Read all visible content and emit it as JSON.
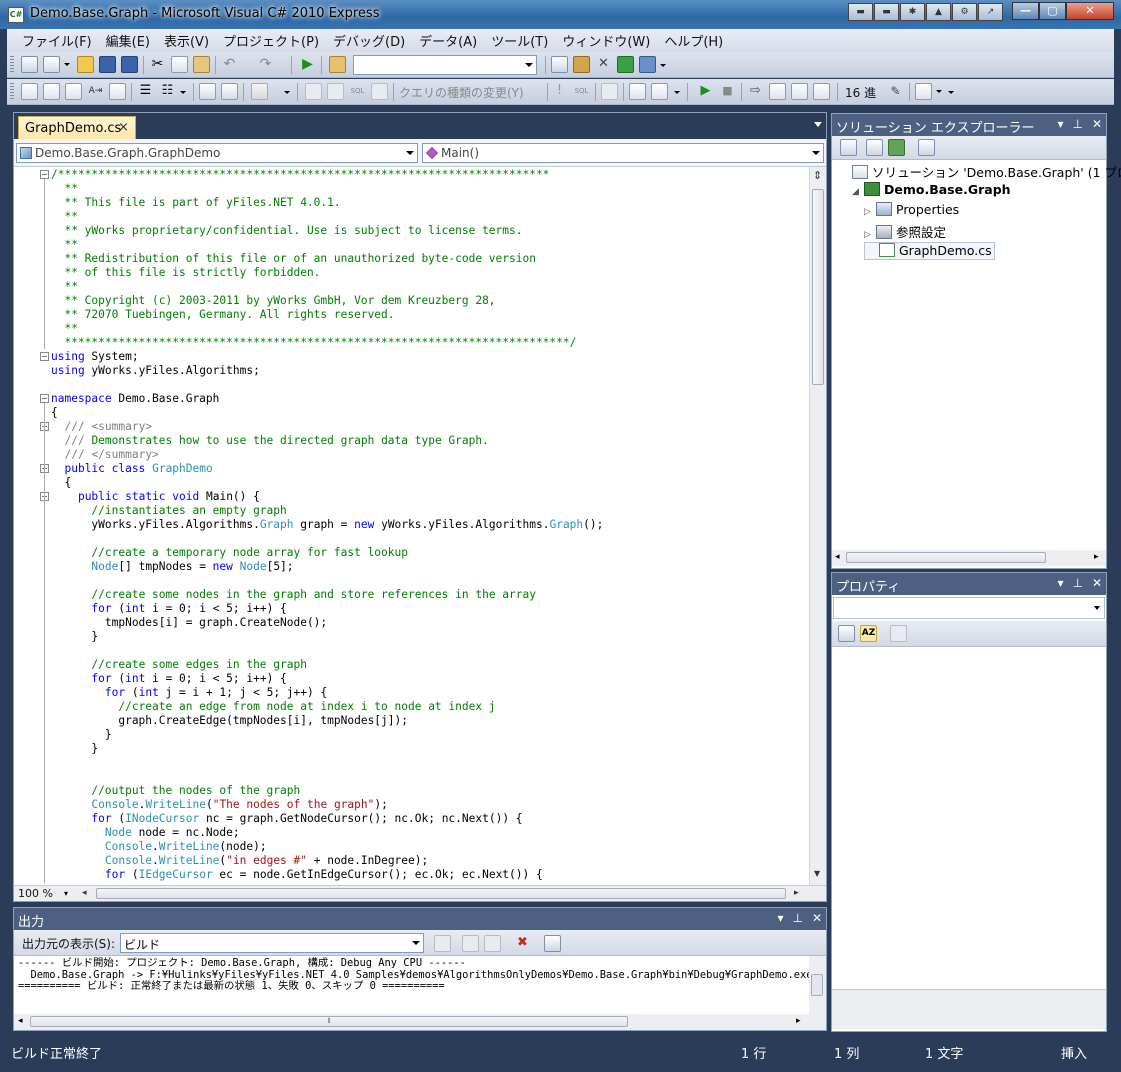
{
  "window": {
    "title": "Demo.Base.Graph - Microsoft Visual C# 2010 Express",
    "app_icon": "C#"
  },
  "menu": [
    "ファイル(F)",
    "編集(E)",
    "表示(V)",
    "プロジェクト(P)",
    "デバッグ(D)",
    "データ(A)",
    "ツール(T)",
    "ウィンドウ(W)",
    "ヘルプ(H)"
  ],
  "toolbar": {
    "query_type_label": "クエリの種類の変更(Y)",
    "hex_label": "16 進"
  },
  "editor": {
    "tab_label": "GraphDemo.cs",
    "tab_close": "×",
    "type_combo": "Demo.Base.Graph.GraphDemo",
    "member_combo": "Main()",
    "zoom": "100 %",
    "code_lines": [
      [
        [
          "cm",
          "/*************************************************************************"
        ]
      ],
      [
        [
          "cm",
          "  **"
        ]
      ],
      [
        [
          "cm",
          "  ** This file is part of yFiles.NET 4.0.1."
        ]
      ],
      [
        [
          "cm",
          "  **"
        ]
      ],
      [
        [
          "cm",
          "  ** yWorks proprietary/confidential. Use is subject to license terms."
        ]
      ],
      [
        [
          "cm",
          "  **"
        ]
      ],
      [
        [
          "cm",
          "  ** Redistribution of this file or of an unauthorized byte-code version"
        ]
      ],
      [
        [
          "cm",
          "  ** of this file is strictly forbidden."
        ]
      ],
      [
        [
          "cm",
          "  **"
        ]
      ],
      [
        [
          "cm",
          "  ** Copyright (c) 2003-2011 by yWorks GmbH, Vor dem Kreuzberg 28,"
        ]
      ],
      [
        [
          "cm",
          "  ** 72070 Tuebingen, Germany. All rights reserved."
        ]
      ],
      [
        [
          "cm",
          "  **"
        ]
      ],
      [
        [
          "cm",
          "  ***************************************************************************/"
        ]
      ],
      [
        [
          "kw",
          "using"
        ],
        [
          "nm",
          " System;"
        ]
      ],
      [
        [
          "kw",
          "using"
        ],
        [
          "nm",
          " yWorks.yFiles.Algorithms;"
        ]
      ],
      [],
      [
        [
          "kw",
          "namespace"
        ],
        [
          "nm",
          " Demo.Base.Graph"
        ]
      ],
      [
        [
          "nm",
          "{"
        ]
      ],
      [
        [
          "nm",
          "  "
        ],
        [
          "xd",
          "///"
        ],
        [
          "xd",
          " <summary>"
        ]
      ],
      [
        [
          "nm",
          "  "
        ],
        [
          "xd",
          "///"
        ],
        [
          "cm",
          " Demonstrates how to use the directed graph data type Graph."
        ]
      ],
      [
        [
          "nm",
          "  "
        ],
        [
          "xd",
          "///"
        ],
        [
          "xd",
          " </summary>"
        ]
      ],
      [
        [
          "nm",
          "  "
        ],
        [
          "kw",
          "public"
        ],
        [
          "nm",
          " "
        ],
        [
          "kw",
          "class"
        ],
        [
          "nm",
          " "
        ],
        [
          "ty",
          "GraphDemo"
        ]
      ],
      [
        [
          "nm",
          "  {"
        ]
      ],
      [
        [
          "nm",
          "    "
        ],
        [
          "kw",
          "public"
        ],
        [
          "nm",
          " "
        ],
        [
          "kw",
          "static"
        ],
        [
          "nm",
          " "
        ],
        [
          "kw",
          "void"
        ],
        [
          "nm",
          " Main() {"
        ]
      ],
      [
        [
          "nm",
          "      "
        ],
        [
          "cm",
          "//instantiates an empty graph"
        ]
      ],
      [
        [
          "nm",
          "      yWorks.yFiles.Algorithms."
        ],
        [
          "ty",
          "Graph"
        ],
        [
          "nm",
          " graph = "
        ],
        [
          "kw",
          "new"
        ],
        [
          "nm",
          " yWorks.yFiles.Algorithms."
        ],
        [
          "ty",
          "Graph"
        ],
        [
          "nm",
          "();"
        ]
      ],
      [],
      [
        [
          "nm",
          "      "
        ],
        [
          "cm",
          "//create a temporary node array for fast lookup"
        ]
      ],
      [
        [
          "nm",
          "      "
        ],
        [
          "ty",
          "Node"
        ],
        [
          "nm",
          "[] tmpNodes = "
        ],
        [
          "kw",
          "new"
        ],
        [
          "nm",
          " "
        ],
        [
          "ty",
          "Node"
        ],
        [
          "nm",
          "[5];"
        ]
      ],
      [],
      [
        [
          "nm",
          "      "
        ],
        [
          "cm",
          "//create some nodes in the graph and store references in the array"
        ]
      ],
      [
        [
          "nm",
          "      "
        ],
        [
          "kw",
          "for"
        ],
        [
          "nm",
          " ("
        ],
        [
          "kw",
          "int"
        ],
        [
          "nm",
          " i = 0; i < 5; i++) {"
        ]
      ],
      [
        [
          "nm",
          "        tmpNodes[i] = graph.CreateNode();"
        ]
      ],
      [
        [
          "nm",
          "      }"
        ]
      ],
      [],
      [
        [
          "nm",
          "      "
        ],
        [
          "cm",
          "//create some edges in the graph"
        ]
      ],
      [
        [
          "nm",
          "      "
        ],
        [
          "kw",
          "for"
        ],
        [
          "nm",
          " ("
        ],
        [
          "kw",
          "int"
        ],
        [
          "nm",
          " i = 0; i < 5; i++) {"
        ]
      ],
      [
        [
          "nm",
          "        "
        ],
        [
          "kw",
          "for"
        ],
        [
          "nm",
          " ("
        ],
        [
          "kw",
          "int"
        ],
        [
          "nm",
          " j = i + 1; j < 5; j++) {"
        ]
      ],
      [
        [
          "nm",
          "          "
        ],
        [
          "cm",
          "//create an edge from node at index i to node at index j"
        ]
      ],
      [
        [
          "nm",
          "          graph.CreateEdge(tmpNodes[i], tmpNodes[j]);"
        ]
      ],
      [
        [
          "nm",
          "        }"
        ]
      ],
      [
        [
          "nm",
          "      }"
        ]
      ],
      [],
      [],
      [
        [
          "nm",
          "      "
        ],
        [
          "cm",
          "//output the nodes of the graph"
        ]
      ],
      [
        [
          "nm",
          "      "
        ],
        [
          "ty",
          "Console"
        ],
        [
          "nm",
          "."
        ],
        [
          "ty",
          "WriteLine"
        ],
        [
          "nm",
          "("
        ],
        [
          "st",
          "\"The nodes of the graph\""
        ],
        [
          "nm",
          ");"
        ]
      ],
      [
        [
          "nm",
          "      "
        ],
        [
          "kw",
          "for"
        ],
        [
          "nm",
          " ("
        ],
        [
          "ty",
          "INodeCursor"
        ],
        [
          "nm",
          " nc = graph.GetNodeCursor(); nc.Ok; nc.Next()) {"
        ]
      ],
      [
        [
          "nm",
          "        "
        ],
        [
          "ty",
          "Node"
        ],
        [
          "nm",
          " node = nc.Node;"
        ]
      ],
      [
        [
          "nm",
          "        "
        ],
        [
          "ty",
          "Console"
        ],
        [
          "nm",
          "."
        ],
        [
          "ty",
          "WriteLine"
        ],
        [
          "nm",
          "(node);"
        ]
      ],
      [
        [
          "nm",
          "        "
        ],
        [
          "ty",
          "Console"
        ],
        [
          "nm",
          "."
        ],
        [
          "ty",
          "WriteLine"
        ],
        [
          "nm",
          "("
        ],
        [
          "st",
          "\"in edges #\""
        ],
        [
          "nm",
          " + node.InDegree);"
        ]
      ],
      [
        [
          "nm",
          "        "
        ],
        [
          "kw",
          "for"
        ],
        [
          "nm",
          " ("
        ],
        [
          "ty",
          "IEdgeCursor"
        ],
        [
          "nm",
          " ec = node.GetInEdgeCursor(); ec.Ok; ec.Next()) {"
        ]
      ]
    ]
  },
  "output": {
    "title": "出力",
    "source_label": "出力元の表示(S):",
    "source_value": "ビルド",
    "lines": [
      "------ ビルド開始: プロジェクト: Demo.Base.Graph, 構成: Debug Any CPU ------",
      "  Demo.Base.Graph -> F:¥Hulinks¥yFiles¥yFiles.NET 4.0 Samples¥demos¥AlgorithmsOnlyDemos¥Demo.Base.Graph¥bin¥Debug¥GraphDemo.exe",
      "========== ビルド: 正常終了または最新の状態 1、失敗 0、スキップ 0 =========="
    ]
  },
  "solution_explorer": {
    "title": "ソリューション エクスプローラー",
    "items": [
      {
        "label": "ソリューション 'Demo.Base.Graph' (1 プロ",
        "level": 0,
        "expander": "",
        "icon": "solution-icon",
        "bold": false
      },
      {
        "label": "Demo.Base.Graph",
        "level": 1,
        "expander": "◢",
        "icon": "csharp-project-icon",
        "bold": true
      },
      {
        "label": "Properties",
        "level": 2,
        "expander": "▷",
        "icon": "properties-folder-icon",
        "bold": false
      },
      {
        "label": "参照設定",
        "level": 2,
        "expander": "▷",
        "icon": "references-folder-icon",
        "bold": false
      },
      {
        "label": "GraphDemo.cs",
        "level": 2,
        "expander": "",
        "icon": "csharp-file-icon",
        "bold": false
      }
    ]
  },
  "properties": {
    "title": "プロパティ"
  },
  "status": {
    "message": "ビルド正常終了",
    "line": "1 行",
    "column": "1 列",
    "char": "1 文字",
    "mode": "挿入"
  }
}
